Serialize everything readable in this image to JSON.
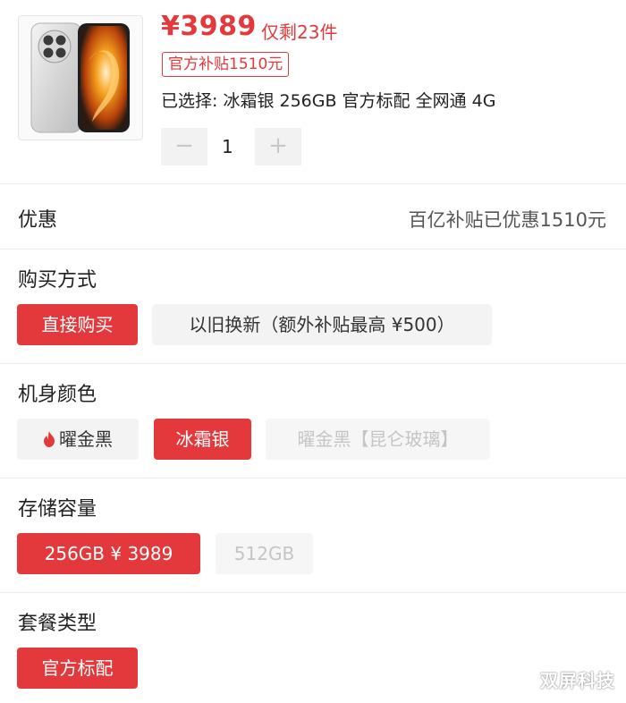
{
  "product": {
    "price": "¥3989",
    "stock": "仅剩23件",
    "subsidy_tag": "官方补贴1510元",
    "selected": "已选择: 冰霜银 256GB 官方标配 全网通 4G",
    "quantity": "1",
    "minus": "−",
    "plus": "+"
  },
  "discount": {
    "label": "优惠",
    "value": "百亿补贴已优惠1510元"
  },
  "purchase": {
    "label": "购买方式",
    "options": [
      {
        "label": "直接购买",
        "state": "selected"
      },
      {
        "label": "以旧换新（额外补贴最高 ¥500）",
        "state": "normal"
      }
    ]
  },
  "color": {
    "label": "机身颜色",
    "options": [
      {
        "label": "曜金黑",
        "state": "normal",
        "icon": "flame-icon"
      },
      {
        "label": "冰霜银",
        "state": "selected"
      },
      {
        "label": "曜金黑【昆仑玻璃】",
        "state": "disabled"
      }
    ]
  },
  "storage": {
    "label": "存储容量",
    "options": [
      {
        "label": "256GB ¥ 3989",
        "state": "selected"
      },
      {
        "label": "512GB",
        "state": "disabled"
      }
    ]
  },
  "package": {
    "label": "套餐类型",
    "options": [
      {
        "label": "官方标配",
        "state": "selected"
      }
    ]
  },
  "watermark": "双屏科技",
  "colors": {
    "accent": "#e4393c",
    "chip_bg": "#f3f3f3",
    "disabled_text": "#c5c5c5"
  }
}
